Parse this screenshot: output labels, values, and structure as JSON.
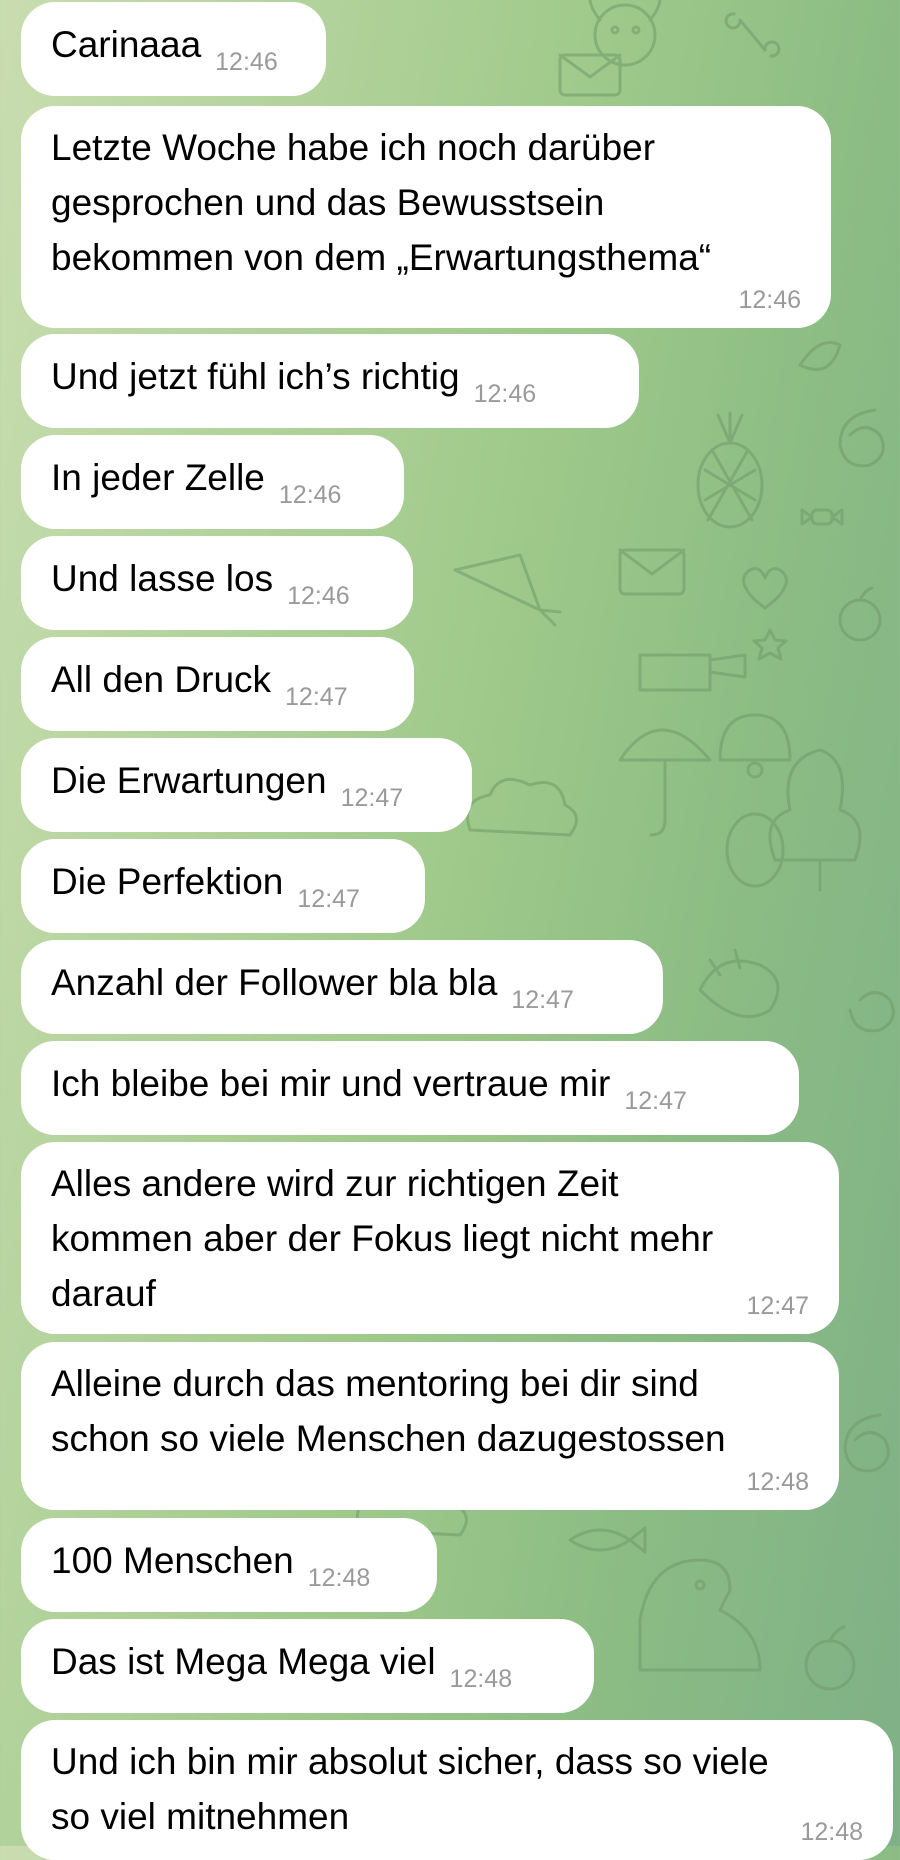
{
  "colors": {
    "bubble_background": "#ffffff",
    "message_text": "#000000",
    "timestamp_text": "#9a9a9a",
    "wallpaper_start": "#c9ddb0",
    "wallpaper_end": "#7fb087",
    "doodle_stroke": "#6f9a68"
  },
  "wallpaper": {
    "style": "doodle-pattern",
    "icons": [
      "dog-icon",
      "envelope-icon",
      "bone-icon",
      "pineapple-icon",
      "apple-icon",
      "heart-icon",
      "star-icon",
      "cactus-icon",
      "umbrella-icon",
      "bell-icon",
      "egg-icon",
      "tree-icon",
      "cloud-icon",
      "carrot-icon",
      "spiral-icon",
      "candy-icon",
      "leaf-icon",
      "fish-icon",
      "dinosaur-icon"
    ]
  },
  "messages": [
    {
      "text": "Carinaaa",
      "time": "12:46"
    },
    {
      "text": "Letzte Woche habe ich noch darüber\ngesprochen und das Bewusstsein\nbekommen von dem „Erwartungsthema“",
      "time": "12:46"
    },
    {
      "text": "Und jetzt fühl ich’s richtig",
      "time": "12:46"
    },
    {
      "text": "In jeder Zelle",
      "time": "12:46"
    },
    {
      "text": "Und lasse los",
      "time": "12:46"
    },
    {
      "text": "All den Druck",
      "time": "12:47"
    },
    {
      "text": "Die Erwartungen",
      "time": "12:47"
    },
    {
      "text": "Die Perfektion",
      "time": "12:47"
    },
    {
      "text": "Anzahl der Follower bla bla",
      "time": "12:47"
    },
    {
      "text": "Ich bleibe bei mir und vertraue mir",
      "time": "12:47"
    },
    {
      "text": "Alles andere wird zur richtigen Zeit\nkommen aber der Fokus liegt nicht mehr\ndarauf",
      "time": "12:47"
    },
    {
      "text": "Alleine durch das mentoring bei dir sind\nschon so viele Menschen dazugestossen",
      "time": "12:48"
    },
    {
      "text": "100 Menschen",
      "time": "12:48"
    },
    {
      "text": "Das ist Mega Mega viel",
      "time": "12:48"
    },
    {
      "text": "Und ich bin mir absolut sicher, dass so viele\nso viel mitnehmen",
      "time": "12:48"
    }
  ]
}
